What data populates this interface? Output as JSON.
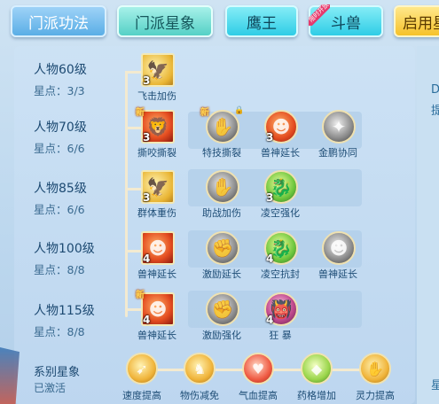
{
  "tabs": [
    {
      "label": "门派功法"
    },
    {
      "label": "门派星象"
    },
    {
      "label": "鹰王"
    },
    {
      "label": "斗兽",
      "badge": "限时开放"
    },
    {
      "label": "启用星"
    }
  ],
  "right_strip": {
    "top_char": "D",
    "mid_char": "提",
    "bottom_char": "星"
  },
  "rows": [
    {
      "level": "人物60级",
      "stars": "星点：3/3",
      "skills": [
        {
          "name": "飞击加伤",
          "count": "3"
        }
      ]
    },
    {
      "level": "人物70级",
      "stars": "星点：6/6",
      "skills": [
        {
          "name": "撕咬撕裂",
          "count": "3",
          "new": "新"
        },
        {
          "name": "特技撕裂",
          "new": "新"
        },
        {
          "name": "兽神延长",
          "count": "3"
        },
        {
          "name": "金鹏协同"
        }
      ]
    },
    {
      "level": "人物85级",
      "stars": "星点：6/6",
      "skills": [
        {
          "name": "群体重伤",
          "count": "3"
        },
        {
          "name": "助战加伤"
        },
        {
          "name": "凌空强化",
          "count": "3"
        }
      ]
    },
    {
      "level": "人物100级",
      "stars": "星点：8/8",
      "skills": [
        {
          "name": "兽神延长",
          "count": "4"
        },
        {
          "name": "激励延长"
        },
        {
          "name": "凌空抗封",
          "count": "4"
        },
        {
          "name": "兽神延长"
        }
      ]
    },
    {
      "level": "人物115级",
      "stars": "星点：8/8",
      "skills": [
        {
          "name": "兽神延长",
          "count": "4",
          "new": "新"
        },
        {
          "name": "激励强化"
        },
        {
          "name": "狂 暴",
          "count": "4"
        }
      ]
    }
  ],
  "series": {
    "title": "系别星象",
    "status": "已激活",
    "items": [
      {
        "name": "速度提高"
      },
      {
        "name": "物伤减免"
      },
      {
        "name": "气血提高"
      },
      {
        "name": "药格增加"
      },
      {
        "name": "灵力提高"
      }
    ]
  },
  "icons": {
    "eagle": "eagle-icon",
    "beast": "beast-icon",
    "warrior": "warrior-icon",
    "shadow": "shadow-icon",
    "dragon": "dragon-icon",
    "mask": "demon-mask-icon"
  }
}
